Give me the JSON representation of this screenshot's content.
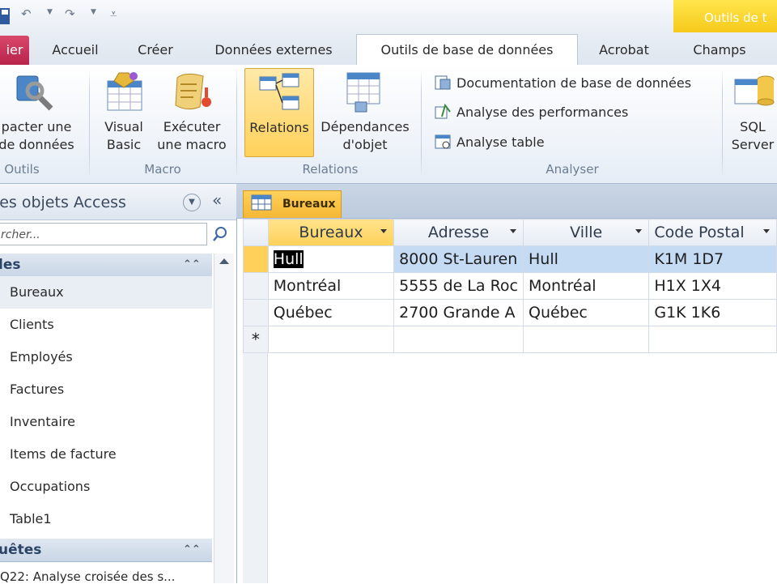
{
  "ribbon": {
    "context_tab": "Outils de t",
    "tabs": [
      "ier",
      "Accueil",
      "Créer",
      "Données externes",
      "Outils de base de données",
      "Acrobat",
      "Champs"
    ],
    "groups": {
      "outils": {
        "label": "Outils",
        "compact_line1": "pacter une",
        "compact_line2": "de données"
      },
      "macro": {
        "label": "Macro",
        "visual_basic_1": "Visual",
        "visual_basic_2": "Basic",
        "exec_macro_1": "Exécuter",
        "exec_macro_2": "une macro"
      },
      "relations": {
        "label": "Relations",
        "relations": "Relations",
        "dependances_1": "Dépendances",
        "dependances_2": "d'objet"
      },
      "analyser": {
        "label": "Analyser",
        "doc": "Documentation de base de données",
        "perf": "Analyse des performances",
        "table": "Analyse table"
      },
      "sql": {
        "line1": "SQL",
        "line2": "Server"
      }
    }
  },
  "nav": {
    "title": "s les objets Access",
    "search_placeholder": "rcher...",
    "section_tables": "les",
    "items": [
      "Bureaux",
      "Clients",
      "Employés",
      "Factures",
      "Inventaire",
      "Items de facture",
      "Occupations",
      "Table1"
    ],
    "section_queries": "uêtes",
    "query_first": "Q22: Analyse croisée des s..."
  },
  "document": {
    "tab_label": "Bureaux",
    "columns": [
      "Bureaux",
      "Adresse",
      "Ville",
      "Code Postal"
    ],
    "rows": [
      [
        "Hull",
        "8000 St-Lauren",
        "Hull",
        "K1M 1D7"
      ],
      [
        "Montréal",
        "5555 de La Roc",
        "Montréal",
        "H1X 1X4"
      ],
      [
        "Québec",
        "2700 Grande A",
        "Québec",
        "G1K 1K6"
      ]
    ],
    "new_row_marker": "*"
  }
}
